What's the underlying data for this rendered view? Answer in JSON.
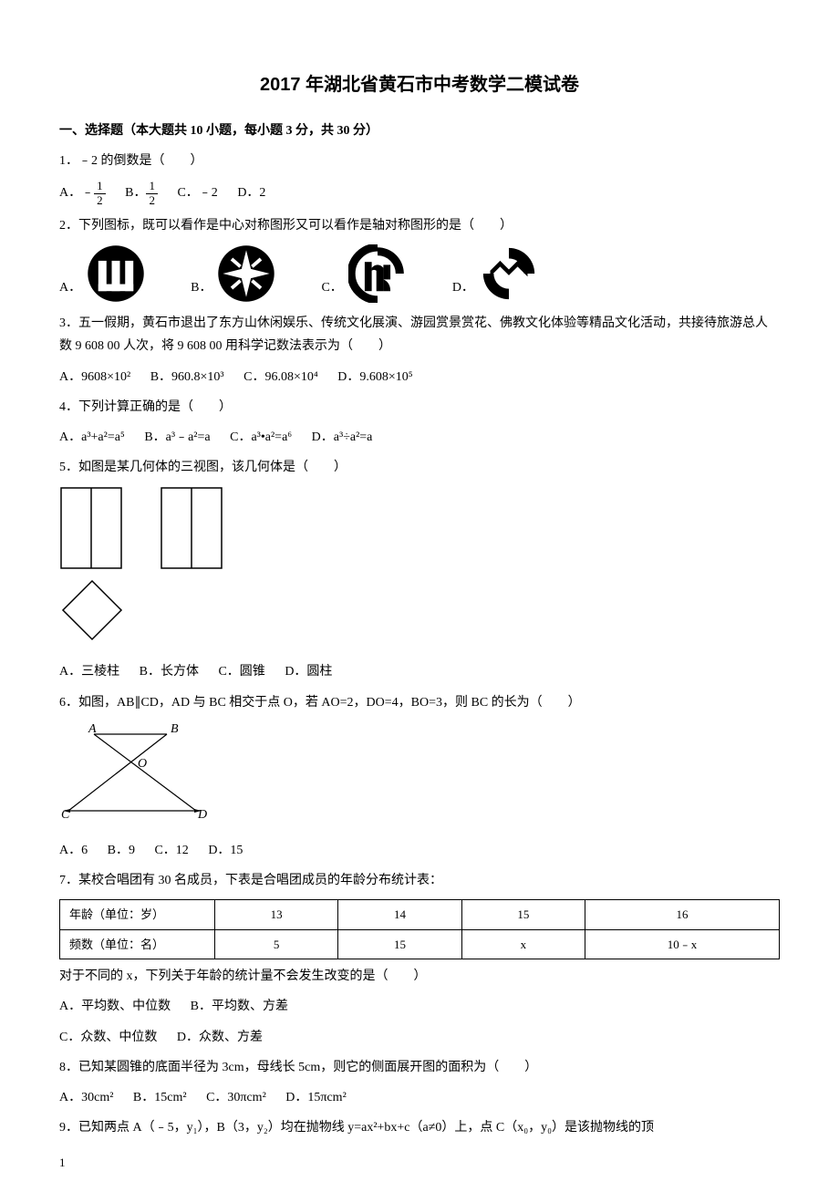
{
  "title": "2017 年湖北省黄石市中考数学二模试卷",
  "section1_header": "一、选择题（本大题共 10 小题，每小题 3 分，共 30 分）",
  "q1": {
    "stem": "1．﹣2 的倒数是（　　）",
    "optA_prefix": "A．﹣",
    "optB_prefix": "B．",
    "frac_num": "1",
    "frac_den": "2",
    "optC": "C．﹣2",
    "optD": "D．2"
  },
  "q2": {
    "stem": "2．下列图标，既可以看作是中心对称图形又可以看作是轴对称图形的是（　　）",
    "labelA": "A．",
    "labelB": "B．",
    "labelC": "C．",
    "labelD": "D．"
  },
  "q3": {
    "stem": "3．五一假期，黄石市退出了东方山休闲娱乐、传统文化展演、游园赏景赏花、佛教文化体验等精品文化活动，共接待旅游总人数 9 608 00 人次，将 9 608 00 用科学记数法表示为（　　）",
    "optA": "A．9608×10²",
    "optB": "B．960.8×10³",
    "optC": "C．96.08×10⁴",
    "optD": "D．9.608×10⁵"
  },
  "q4": {
    "stem": "4．下列计算正确的是（　　）",
    "optA": "A．a³+a²=a⁵",
    "optB": "B．a³﹣a²=a",
    "optC": "C．a³•a²=a⁶",
    "optD": "D．a³÷a²=a"
  },
  "q5": {
    "stem": "5．如图是某几何体的三视图，该几何体是（　　）",
    "optA": "A．三棱柱",
    "optB": "B．长方体",
    "optC": "C．圆锥",
    "optD": "D．圆柱"
  },
  "q6": {
    "stem": "6．如图，AB∥CD，AD 与 BC 相交于点 O，若 AO=2，DO=4，BO=3，则 BC 的长为（　　）",
    "labelA": "A",
    "labelB": "B",
    "labelC": "C",
    "labelD": "D",
    "labelO": "O",
    "optA": "A．6",
    "optB": "B．9",
    "optC": "C．12",
    "optD": "D．15"
  },
  "q7": {
    "stem": "7．某校合唱团有 30 名成员，下表是合唱团成员的年龄分布统计表：",
    "row1_label": "年龄（单位：岁）",
    "row2_label": "频数（单位：名）",
    "cols": [
      "13",
      "14",
      "15",
      "16"
    ],
    "freqs": [
      "5",
      "15",
      "x",
      "10﹣x"
    ],
    "tail": "对于不同的 x，下列关于年龄的统计量不会发生改变的是（　　）",
    "optA": "A．平均数、中位数",
    "optB": "B．平均数、方差",
    "optC": "C．众数、中位数",
    "optD": "D．众数、方差"
  },
  "q8": {
    "stem": "8．已知某圆锥的底面半径为 3cm，母线长 5cm，则它的侧面展开图的面积为（　　）",
    "optA": "A．30cm²",
    "optB": "B．15cm²",
    "optC": "C．30πcm²",
    "optD": "D．15πcm²"
  },
  "q9": {
    "stem": " 9．已知两点 A（﹣5，y₁），B（3，y₂）均在抛物线 y=ax²+bx+c（a≠0）上，点 C（x₀，y₀）是该抛物线的顶"
  },
  "page_number": "1"
}
